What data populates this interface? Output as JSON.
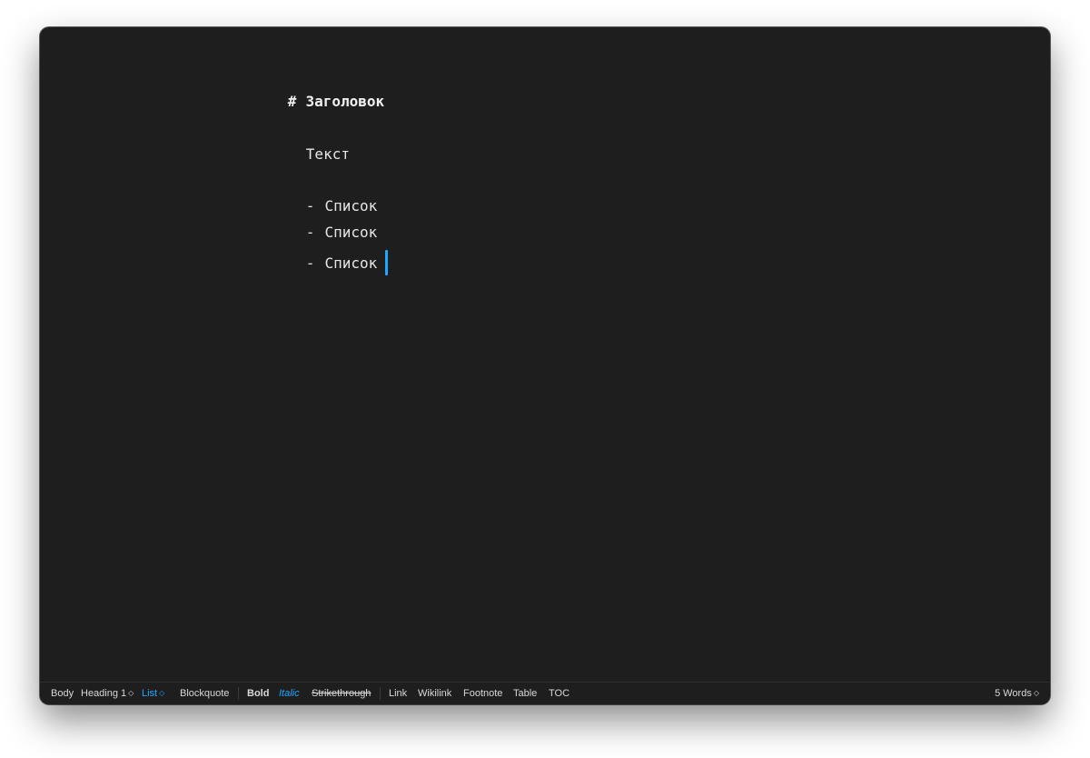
{
  "editor": {
    "heading_marker": "#",
    "heading_text": "Заголовок",
    "paragraph": "Текст",
    "list_marker": "-",
    "list_items": [
      "Список",
      "Список",
      "Список"
    ]
  },
  "toolbar": {
    "body": "Body",
    "heading": "Heading 1",
    "list": "List",
    "blockquote": "Blockquote",
    "bold": "Bold",
    "italic": "Italic",
    "strikethrough": "Strikethrough",
    "link": "Link",
    "wikilink": "Wikilink",
    "footnote": "Footnote",
    "table": "Table",
    "toc": "TOC",
    "word_count": "5 Words",
    "chevron": "◇"
  },
  "colors": {
    "background": "#1e1e1e",
    "text": "#e6e6e6",
    "accent": "#1ea7ff"
  },
  "icons": {
    "dropdown": "updown-chevron-icon",
    "cursor": "text-cursor"
  }
}
